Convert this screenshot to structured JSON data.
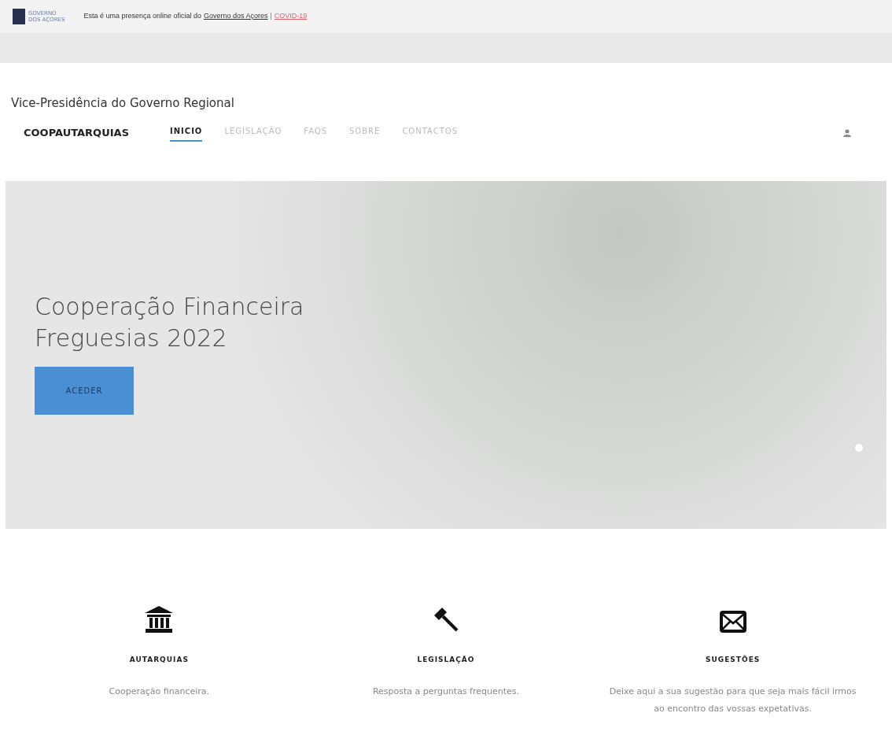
{
  "gov_bar": {
    "logo_text": [
      "GOVERNO",
      "DOS AÇORES"
    ],
    "notice": "Esta é uma presença online oficial do",
    "link": "Governo dos Açores",
    "separator": "|",
    "covid_link": "COVID-19"
  },
  "header": {
    "org": "Vice-Presidência do Governo Regional",
    "brand": "COOPAUTARQUIAS",
    "nav": [
      {
        "label": "INICIO",
        "selected": true
      },
      {
        "label": "LEGISLAÇÃO",
        "selected": false
      },
      {
        "label": "FAQS",
        "selected": false
      },
      {
        "label": "SOBRE",
        "selected": false
      },
      {
        "label": "CONTACTOS",
        "selected": false
      }
    ]
  },
  "hero": {
    "title": [
      "Cooperação Financeira",
      "Freguesias 2022"
    ],
    "button": "ACEDER"
  },
  "features": [
    {
      "kind": "bank",
      "title": "AUTARQUIAS",
      "text": "Cooperação financeira."
    },
    {
      "kind": "gavel",
      "title": "LEGISLAÇÃO",
      "text": "Resposta a perguntas frequentes."
    },
    {
      "kind": "mail",
      "title": "SUGESTÕES",
      "text": "Deixe aqui a sua sugestão para que seja mais fácil irmos ao encontro das vossas expetativas."
    }
  ]
}
